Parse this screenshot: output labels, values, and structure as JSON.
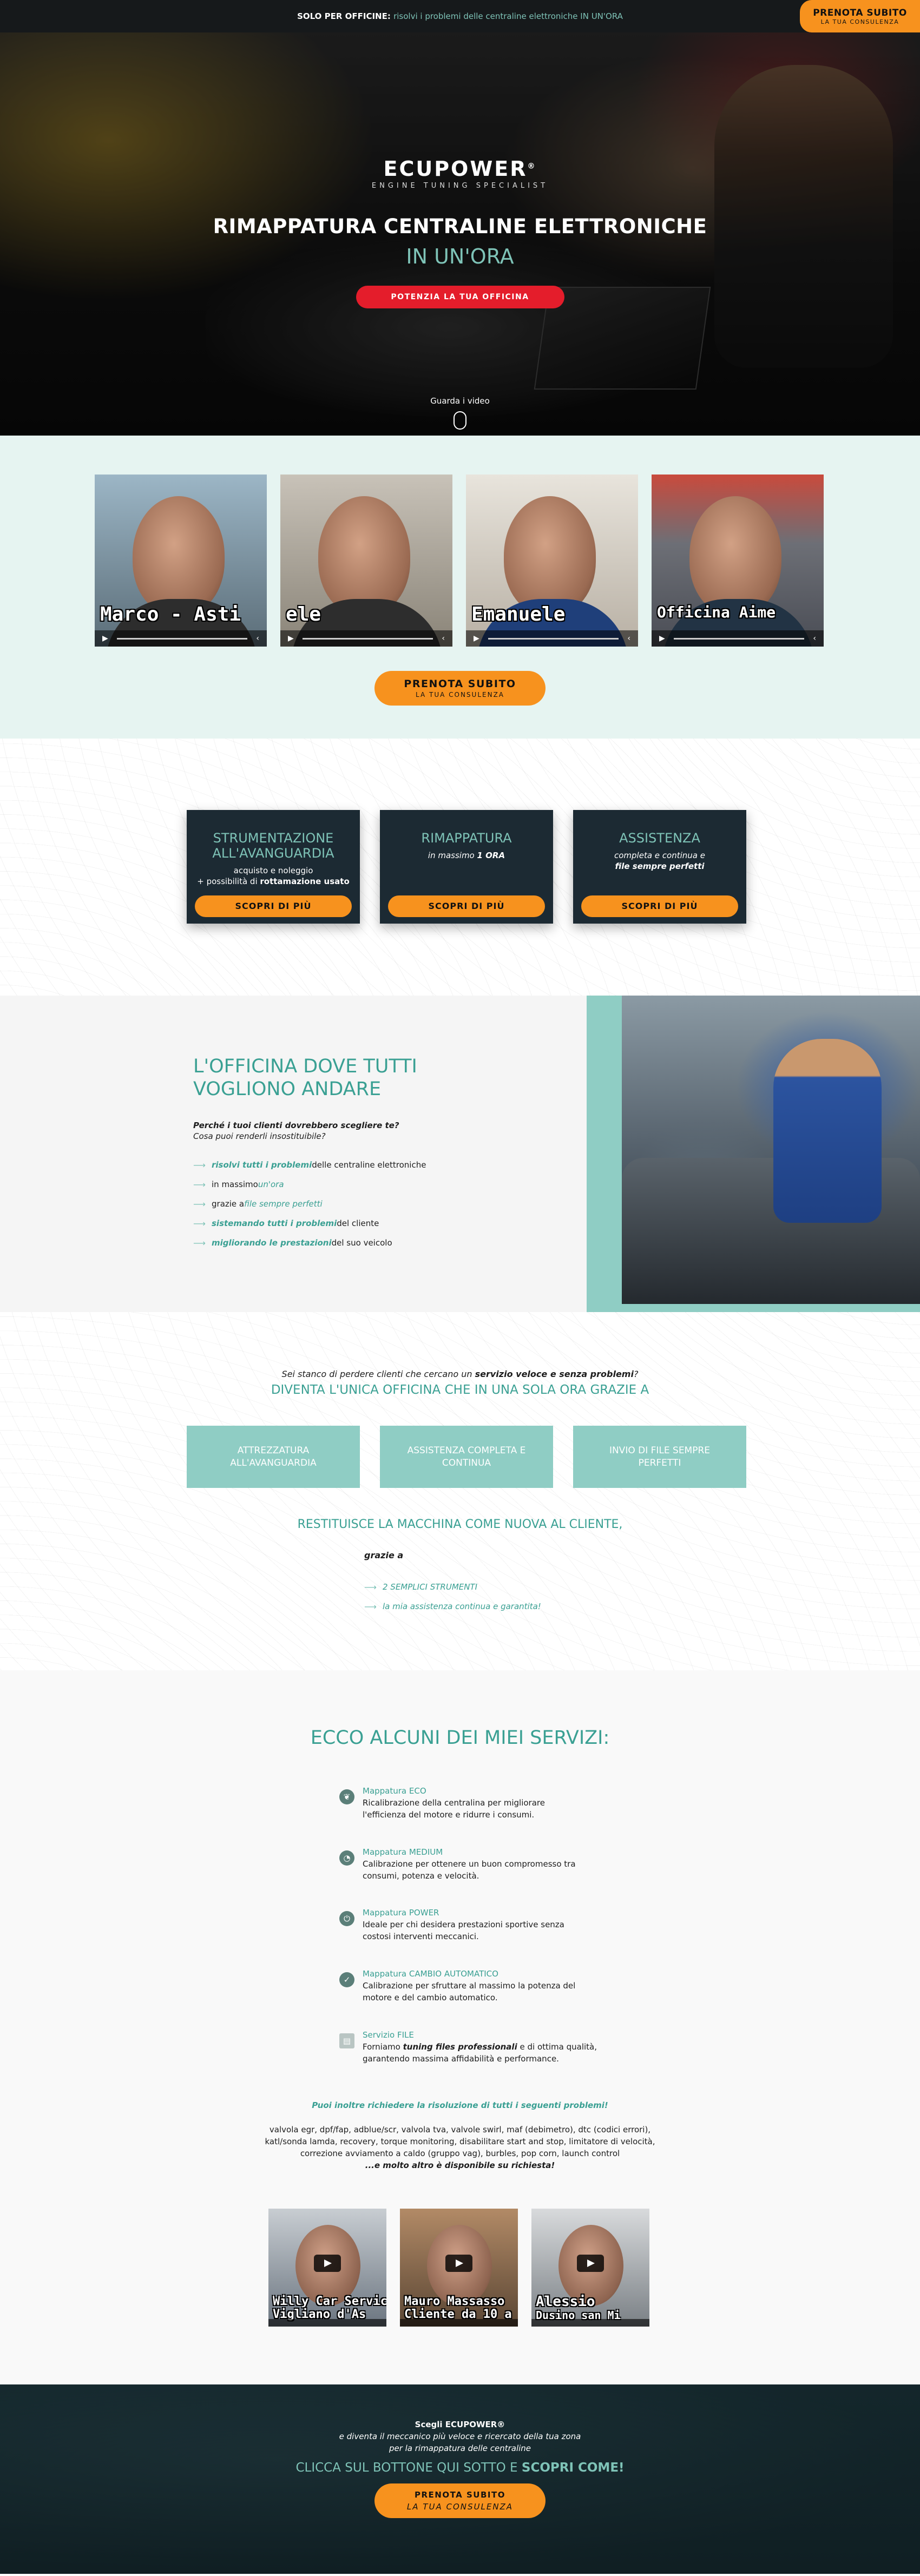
{
  "topbar": {
    "prefix": "SOLO PER OFFICINE:",
    "highlight": "risolvi i problemi delle centraline elettroniche IN UN'ORA",
    "cta_line1": "PRENOTA SUBITO",
    "cta_line2": "LA TUA CONSULENZA"
  },
  "hero": {
    "logo": "ECUPOWER",
    "logo_reg": "®",
    "logo_sub": "ENGINE TUNING SPECIALIST",
    "title": "RIMAPPATURA CENTRALINE ELETTRONICHE",
    "subtitle": "IN UN'ORA",
    "button": "POTENZIA LA TUA OFFICINA",
    "watch": "Guarda i video"
  },
  "testimonials": {
    "videos": [
      {
        "name": "Marco - Asti"
      },
      {
        "name": "ele"
      },
      {
        "name": "Emanuele"
      },
      {
        "name": "Officina Aime"
      }
    ],
    "cta_line1": "PRENOTA SUBITO",
    "cta_line2": "LA TUA CONSULENZA"
  },
  "service_cards": [
    {
      "title1": "STRUMENTAZIONE",
      "title2": "ALL'AVANGUARDIA",
      "desc1": "acquisto e noleggio",
      "desc2_pre": "+ possibilità di ",
      "desc2_b": "rottamazione usato",
      "button": "SCOPRI DI PIÙ"
    },
    {
      "title1": "RIMAPPATURA",
      "title2": "",
      "desc1_pre": "in massimo ",
      "desc1_b": "1 ORA",
      "button": "SCOPRI DI PIÙ"
    },
    {
      "title1": "ASSISTENZA",
      "title2": "",
      "desc1": "completa e continua e",
      "desc2_b": "file sempre perfetti",
      "button": "SCOPRI DI PIÙ"
    }
  ],
  "officina": {
    "title1": "L'OFFICINA DOVE TUTTI",
    "title2": "VOGLIONO ANDARE",
    "q1": "Perché i tuoi clienti dovrebbero scegliere te?",
    "q2": "Cosa puoi renderli insostituibile?",
    "items": [
      {
        "hl": "risolvi tutti i problemi",
        "rest": " delle centraline elettroniche"
      },
      {
        "pre": "in massimo ",
        "hl": "un'ora",
        "rest": ""
      },
      {
        "pre": "grazie a ",
        "hl": "file sempre perfetti",
        "rest": ""
      },
      {
        "hl": "sistemando tutti i problemi",
        "rest": " del cliente"
      },
      {
        "hl": "migliorando le prestazioni",
        "rest": " del suo veicolo"
      }
    ]
  },
  "stanco": {
    "q1_pre": "Sei stanco di perdere clienti che cercano un ",
    "q1_b": "servizio veloce e senza problemi",
    "q1_post": "?",
    "q2": "DIVENTA L'UNICA OFFICINA CHE IN UNA SOLA ORA GRAZIE A",
    "cards": [
      {
        "l1": "ATTREZZATURA",
        "l2": "ALL'AVANGUARDIA"
      },
      {
        "l1": "ASSISTENZA COMPLETA E",
        "l2": "CONTINUA"
      },
      {
        "l1": "INVIO DI FILE SEMPRE",
        "l2": "PERFETTI"
      }
    ],
    "restituisce": "RESTITUISCE LA MACCHINA COME NUOVA AL CLIENTE,",
    "grazie": "grazie a",
    "items": [
      "2 SEMPLICI STRUMENTI",
      "la mia assistenza continua e garantita!"
    ]
  },
  "servizi": {
    "title": "ECCO ALCUNI DEI MIEI SERVIZI:",
    "items": [
      {
        "icon": "leaf-icon",
        "glyph": "❦",
        "title": "Mappatura ECO",
        "d1": "Ricalibrazione della centralina per migliorare",
        "d2": "l'efficienza del motore e ridurre i consumi."
      },
      {
        "icon": "gauge-icon",
        "glyph": "◔",
        "title": "Mappatura MEDIUM",
        "d1": "Calibrazione per ottenere un buon compromesso tra",
        "d2": "consumi, potenza e velocità."
      },
      {
        "icon": "power-icon",
        "glyph": "⏻",
        "title": "Mappatura POWER",
        "d1": "Ideale per chi desidera prestazioni sportive senza",
        "d2": "costosi interventi meccanici."
      },
      {
        "icon": "check-icon",
        "glyph": "✓",
        "title": "Mappatura CAMBIO AUTOMATICO",
        "d1": "Calibrazione per sfruttare al massimo la potenza del",
        "d2": "motore e del cambio automatico."
      },
      {
        "icon": "file-icon",
        "glyph": "▤",
        "title": "Servizio FILE",
        "d1_pre": "Forniamo ",
        "d1_b": "tuning files professionali",
        "d1_post": " e di ottima qualità,",
        "d2": "garantendo massima affidabilità e performance."
      }
    ],
    "pu": "Puoi inoltre richiedere la risoluzione di tutti i seguenti problemi!",
    "list": [
      "valvola egr, dpf/fap, adblue/scr, valvola tva, valvole swirl, maf (debimetro), dtc (codici errori),",
      "katl/sonda lamda, recovery, torque monitoring, disabilitare start and stop, limitatore di velocità,",
      "correzione avviamento a caldo (gruppo vag), burbles, pop corn, launch control"
    ],
    "list_last": "...e molto altro è disponibile su richiesta!",
    "videos": [
      {
        "l1": "Willy Car Service",
        "l2": "Vigliano d'As"
      },
      {
        "l1": "Mauro Massasso",
        "l2": "Cliente da 10 a"
      },
      {
        "l1": "Alessio",
        "l2": "Dusino san Mi"
      }
    ]
  },
  "footer": {
    "l1": "Scegli ECUPOWER®",
    "l2": "e diventa il meccanico più veloce e ricercato della tua zona",
    "l3": "per la rimappatura delle centraline",
    "l4_pre": "CLICCA SUL BOTTONE QUI SOTTO E ",
    "l4_b": "SCOPRI COME!",
    "cta_line1": "PRENOTA SUBITO",
    "cta_line2": "LA TUA CONSULENZA"
  },
  "colors": {
    "teal": "#7ec3b7",
    "teal_dark": "#3aa093",
    "orange": "#f7921e",
    "red": "#e41d2b",
    "navy": "#1c2a33"
  }
}
